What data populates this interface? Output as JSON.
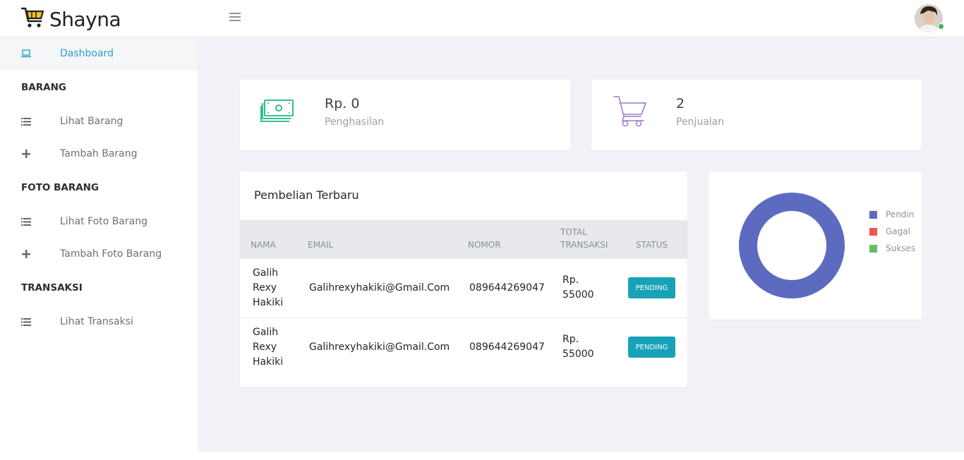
{
  "brand": {
    "name": "Shayna"
  },
  "sidebar": {
    "dashboard": "Dashboard",
    "sections": [
      {
        "heading": "BARANG",
        "items": [
          "Lihat Barang",
          "Tambah Barang"
        ]
      },
      {
        "heading": "FOTO BARANG",
        "items": [
          "Lihat Foto Barang",
          "Tambah Foto Barang"
        ]
      },
      {
        "heading": "TRANSAKSI",
        "items": [
          "Lihat Transaksi"
        ]
      }
    ]
  },
  "stats": {
    "income": {
      "value": "Rp. 0",
      "label": "Penghasilan",
      "icon": "money-icon",
      "color": "#1fb584"
    },
    "sales": {
      "value": "2",
      "label": "Penjualan",
      "icon": "cart-icon",
      "color": "#a98ad4"
    }
  },
  "table": {
    "title": "Pembelian Terbaru",
    "headers": {
      "nama": "NAMA",
      "email": "EMAIL",
      "nomor": "NOMOR",
      "total_1": "TOTAL",
      "total_2": "TRANSAKSI",
      "status": "STATUS"
    },
    "rows": [
      {
        "nama": [
          "Galih",
          "Rexy",
          "Hakiki"
        ],
        "email": "Galihrexyhakiki@Gmail.Com",
        "nomor": "089644269047",
        "total": [
          "Rp.",
          "55000"
        ],
        "status": "PENDING"
      },
      {
        "nama": [
          "Galih",
          "Rexy",
          "Hakiki"
        ],
        "email": "Galihrexyhakiki@Gmail.Com",
        "nomor": "089644269047",
        "total": [
          "Rp.",
          "55000"
        ],
        "status": "PENDING"
      }
    ]
  },
  "donut": {
    "legend": [
      {
        "label": "Pendin",
        "color": "#5c6bc0"
      },
      {
        "label": "Gagal",
        "color": "#ef5350"
      },
      {
        "label": "Sukses",
        "color": "#66bb6a"
      }
    ]
  },
  "chart_data": {
    "type": "pie",
    "categories": [
      "Pendin",
      "Gagal",
      "Sukses"
    ],
    "values": [
      2,
      0,
      0
    ],
    "colors": [
      "#5c6bc0",
      "#ef5350",
      "#66bb6a"
    ],
    "legend_position": "right"
  }
}
